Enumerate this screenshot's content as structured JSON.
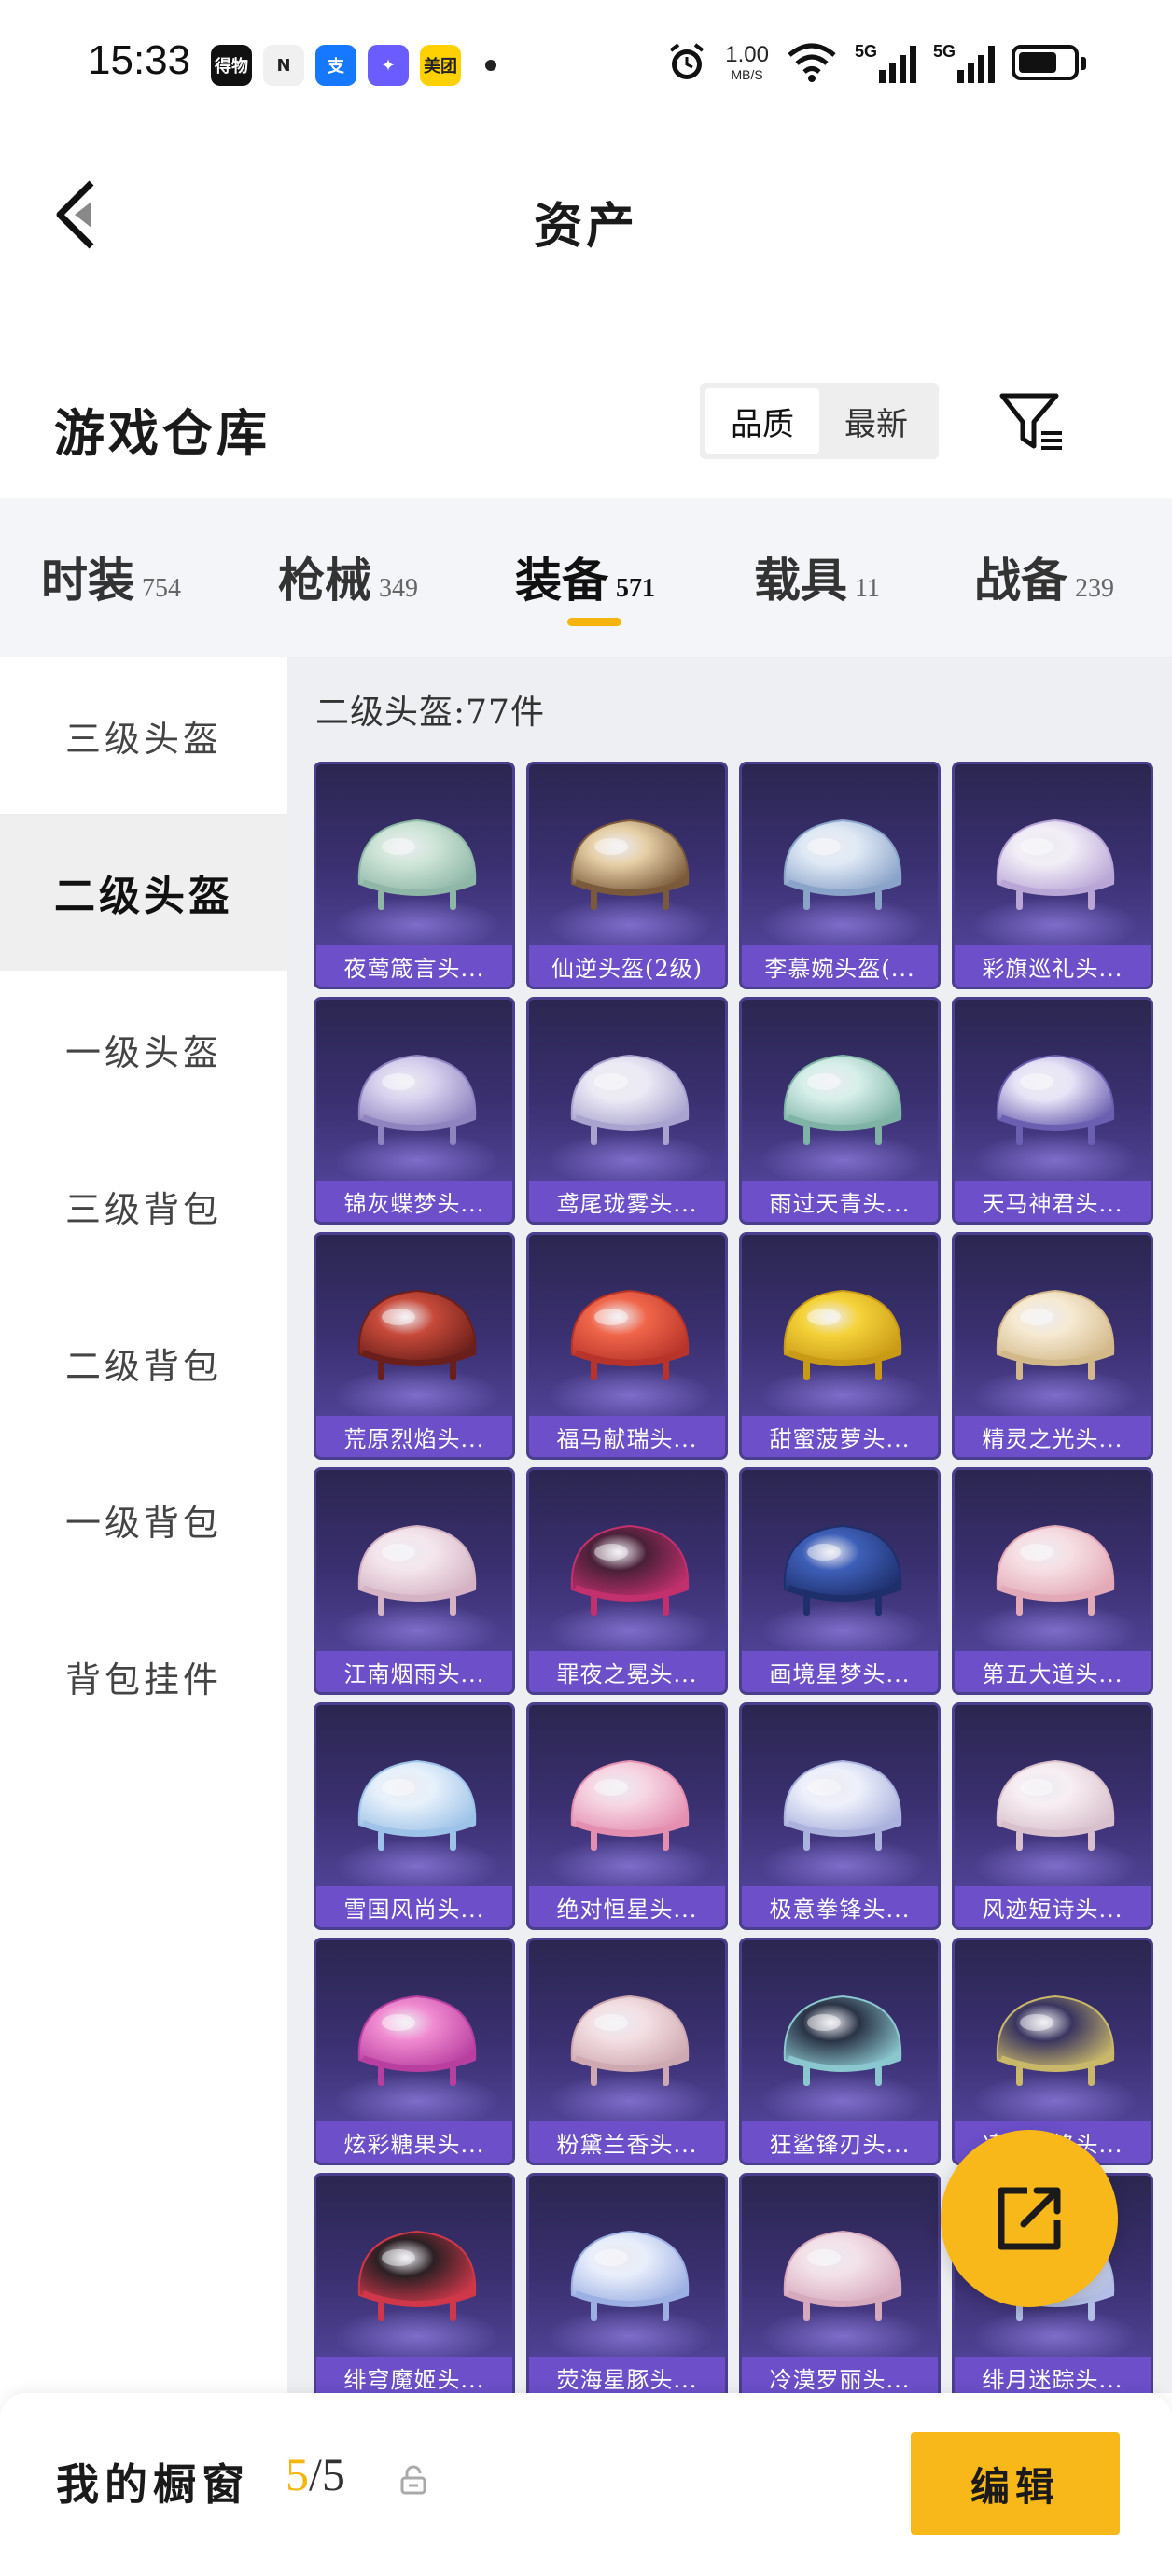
{
  "status_bar": {
    "time": "15:33",
    "apps": [
      {
        "icon": "dewu-app-icon",
        "text": "得物",
        "color": "#111111"
      },
      {
        "icon": "n-app-icon",
        "text": "N",
        "color": "#f0f0f0"
      },
      {
        "icon": "alipay-app-icon",
        "text": "支",
        "color": "#1677ff"
      },
      {
        "icon": "star-app-icon",
        "text": "✦",
        "color": "#6a5cff"
      },
      {
        "icon": "meituan-app-icon",
        "text": "美团",
        "color": "#ffd100"
      }
    ],
    "net_speed_value": "1.00",
    "net_speed_unit": "MB/S",
    "signal_1_label": "5G",
    "signal_2_label": "5G"
  },
  "header": {
    "title": "资产"
  },
  "warehouse": {
    "title": "游戏仓库",
    "sort_options": [
      "品质",
      "最新"
    ],
    "active_sort": 0
  },
  "tabs": [
    {
      "name": "时装",
      "count": "754"
    },
    {
      "name": "枪械",
      "count": "349"
    },
    {
      "name": "装备",
      "count": "571"
    },
    {
      "name": "载具",
      "count": "11"
    },
    {
      "name": "战备",
      "count": "239"
    }
  ],
  "active_tab": 2,
  "sidebar": {
    "items": [
      "三级头盔",
      "二级头盔",
      "一级头盔",
      "三级背包",
      "二级背包",
      "一级背包",
      "背包挂件"
    ],
    "active": 1
  },
  "main": {
    "heading": "二级头盔:77件",
    "items": [
      {
        "label": "夜莺箴言头...",
        "c1": "#cfe6d8",
        "c2": "#8fb7a8"
      },
      {
        "label": "仙逆头盔(2级)",
        "c1": "#e6cfa6",
        "c2": "#7a5a3a"
      },
      {
        "label": "李慕婉头盔(...",
        "c1": "#dfe9f5",
        "c2": "#8aa3c9"
      },
      {
        "label": "彩旗巡礼头...",
        "c1": "#f2eef7",
        "c2": "#b9a6d6"
      },
      {
        "label": "锦灰蝶梦头...",
        "c1": "#d9d3ef",
        "c2": "#8f84c0"
      },
      {
        "label": "鸢尾珑雾头...",
        "c1": "#ecebf5",
        "c2": "#a9a3cf"
      },
      {
        "label": "雨过天青头...",
        "c1": "#d6efe9",
        "c2": "#7fb3a6"
      },
      {
        "label": "天马神君头...",
        "c1": "#e8e4f7",
        "c2": "#6a5fb0"
      },
      {
        "label": "荒原烈焰头...",
        "c1": "#c74a3a",
        "c2": "#6b1f1a"
      },
      {
        "label": "福马献瑞头...",
        "c1": "#f0664a",
        "c2": "#b8342a"
      },
      {
        "label": "甜蜜菠萝头...",
        "c1": "#f5d33a",
        "c2": "#c99a16"
      },
      {
        "label": "精灵之光头...",
        "c1": "#f6ead2",
        "c2": "#d3b98a"
      },
      {
        "label": "江南烟雨头...",
        "c1": "#f4e6ec",
        "c2": "#d5b3c4"
      },
      {
        "label": "罪夜之冕头...",
        "c1": "#4a2038",
        "c2": "#c2306e"
      },
      {
        "label": "画境星梦头...",
        "c1": "#3e5fb8",
        "c2": "#1e2f6b"
      },
      {
        "label": "第五大道头...",
        "c1": "#f6dfe4",
        "c2": "#e3a9b7"
      },
      {
        "label": "雪国风尚头...",
        "c1": "#e7f1fb",
        "c2": "#9ec3e8"
      },
      {
        "label": "绝对恒星头...",
        "c1": "#f6d6e3",
        "c2": "#e58fb0"
      },
      {
        "label": "极意拳锋头...",
        "c1": "#eef0fb",
        "c2": "#aab2dd"
      },
      {
        "label": "风迹短诗头...",
        "c1": "#f7eef2",
        "c2": "#d8c0cc"
      },
      {
        "label": "炫彩糖果头...",
        "c1": "#f08ad0",
        "c2": "#b83fa0"
      },
      {
        "label": "粉黛兰香头...",
        "c1": "#f3dfe3",
        "c2": "#cfa9b1"
      },
      {
        "label": "狂鲨锋刃头...",
        "c1": "#2a3346",
        "c2": "#8bc7cf"
      },
      {
        "label": "凌霄龙焰头...",
        "c1": "#3a3560",
        "c2": "#c9b86a"
      },
      {
        "label": "绯穹魔姬头...",
        "c1": "#2b2024",
        "c2": "#d0384a"
      },
      {
        "label": "荧海星豚头...",
        "c1": "#e8eefb",
        "c2": "#9db0e3"
      },
      {
        "label": "冷漠罗丽头...",
        "c1": "#f3e1e8",
        "c2": "#d7a9bd"
      },
      {
        "label": "绯月迷踪头...",
        "c1": "#f0f2fb",
        "c2": "#b3bfe6"
      }
    ]
  },
  "bottom": {
    "label": "我的橱窗",
    "current": "5",
    "separator": "/",
    "total": "5",
    "edit_label": "编辑"
  },
  "colors": {
    "accent": "#f9b81a",
    "card_label_bg": "#6c4fc9",
    "card_bg_top": "#2b2650",
    "card_bg_bottom": "#5a4aa6"
  }
}
